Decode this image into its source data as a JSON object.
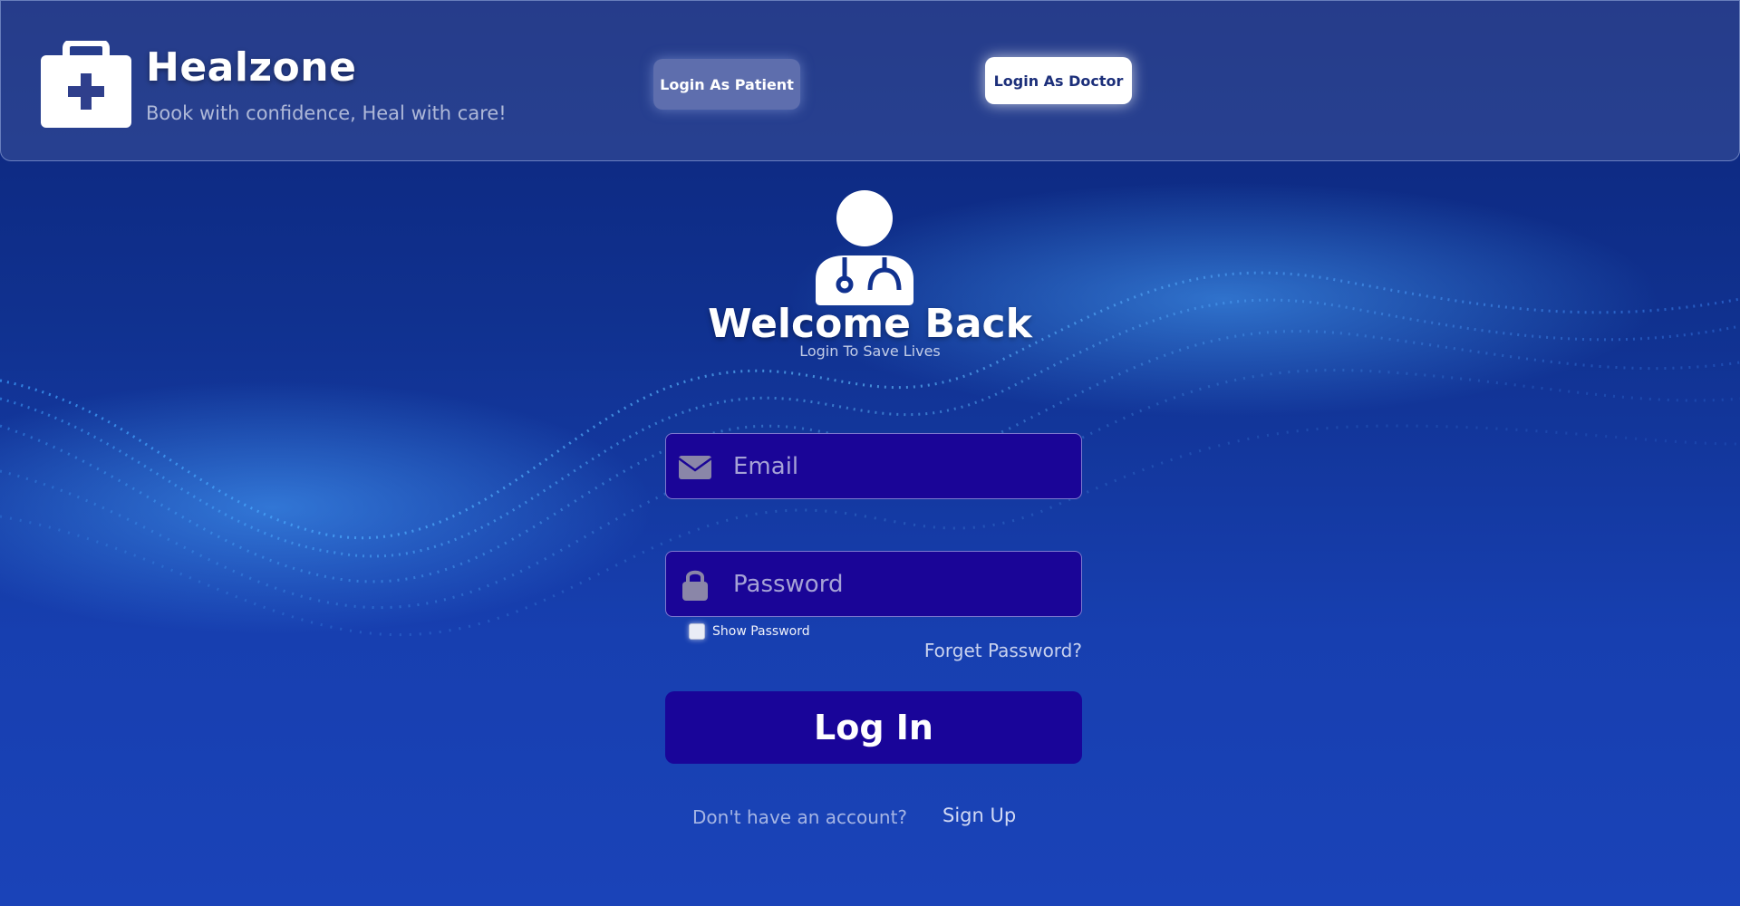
{
  "header": {
    "brand_title": "Healzone",
    "tagline": "Book with confidence, Heal with care!",
    "login_patient_label": "Login As Patient",
    "login_doctor_label": "Login As Doctor"
  },
  "login": {
    "title": "Welcome Back",
    "subtitle": "Login To Save Lives",
    "email_placeholder": "Email",
    "email_value": "",
    "password_placeholder": "Password",
    "password_value": "",
    "show_password_label": "Show Password",
    "show_password_checked": false,
    "forgot_label": "Forget Password?",
    "login_button_label": "Log In",
    "no_account_text": "Don't have an account?",
    "signup_label": "Sign Up"
  },
  "icons": {
    "logo": "medical-kit-icon",
    "avatar": "doctor-icon",
    "email": "envelope-icon",
    "password": "lock-icon"
  },
  "colors": {
    "background_top": "#0b2479",
    "background_bottom": "#1a43b8",
    "field_bg": "#1a0597",
    "login_button_bg": "#190599",
    "doctor_button_bg": "#ffffff",
    "doctor_button_text": "#1c2f7a"
  }
}
